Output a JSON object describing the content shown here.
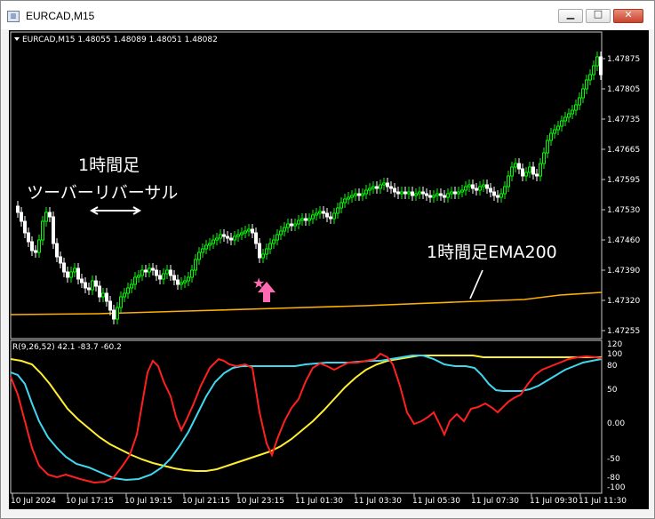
{
  "window": {
    "title": "EURCAD,M15",
    "icon_name": "chart-window-icon",
    "min_icon": "minimize-icon",
    "max_icon": "maximize-icon",
    "close_icon": "close-icon"
  },
  "main_chart": {
    "header": "EURCAD,M15  1.48055 1.48089 1.48051 1.48082",
    "header_arrow_icon": "triangle-down-icon",
    "price_labels": [
      "1.47875",
      "1.47805",
      "1.47735",
      "1.47665",
      "1.47595",
      "1.47530",
      "1.47460",
      "1.47390",
      "1.47320",
      "1.47255"
    ],
    "annotations": {
      "left_line1": "1時間足",
      "left_line2": "ツーバーリバーサル",
      "right": "1時間足EMA200"
    },
    "signal_icons": [
      "star-icon",
      "up-arrow-icon"
    ],
    "colors": {
      "bull": "#00ff00",
      "bear": "#ffffff",
      "ema": "#ffb000",
      "marker": "#ff69b4"
    }
  },
  "indicator": {
    "header": "R(9,26,52) 42.1 -83.7 -60.2",
    "levels": [
      "120",
      "100",
      "80",
      "50",
      "0.00",
      "-50",
      "-80",
      "-100"
    ],
    "colors": {
      "red": "#ff2020",
      "cyan": "#40d8f0",
      "yellow": "#ffee30"
    }
  },
  "time_axis": [
    "10 Jul 2024",
    "10 Jul 17:15",
    "10 Jul 19:15",
    "10 Jul 21:15",
    "10 Jul 23:15",
    "11 Jul 01:30",
    "11 Jul 03:30",
    "11 Jul 05:30",
    "11 Jul 07:30",
    "11 Jul 09:30",
    "11 Jul 11:30"
  ]
}
